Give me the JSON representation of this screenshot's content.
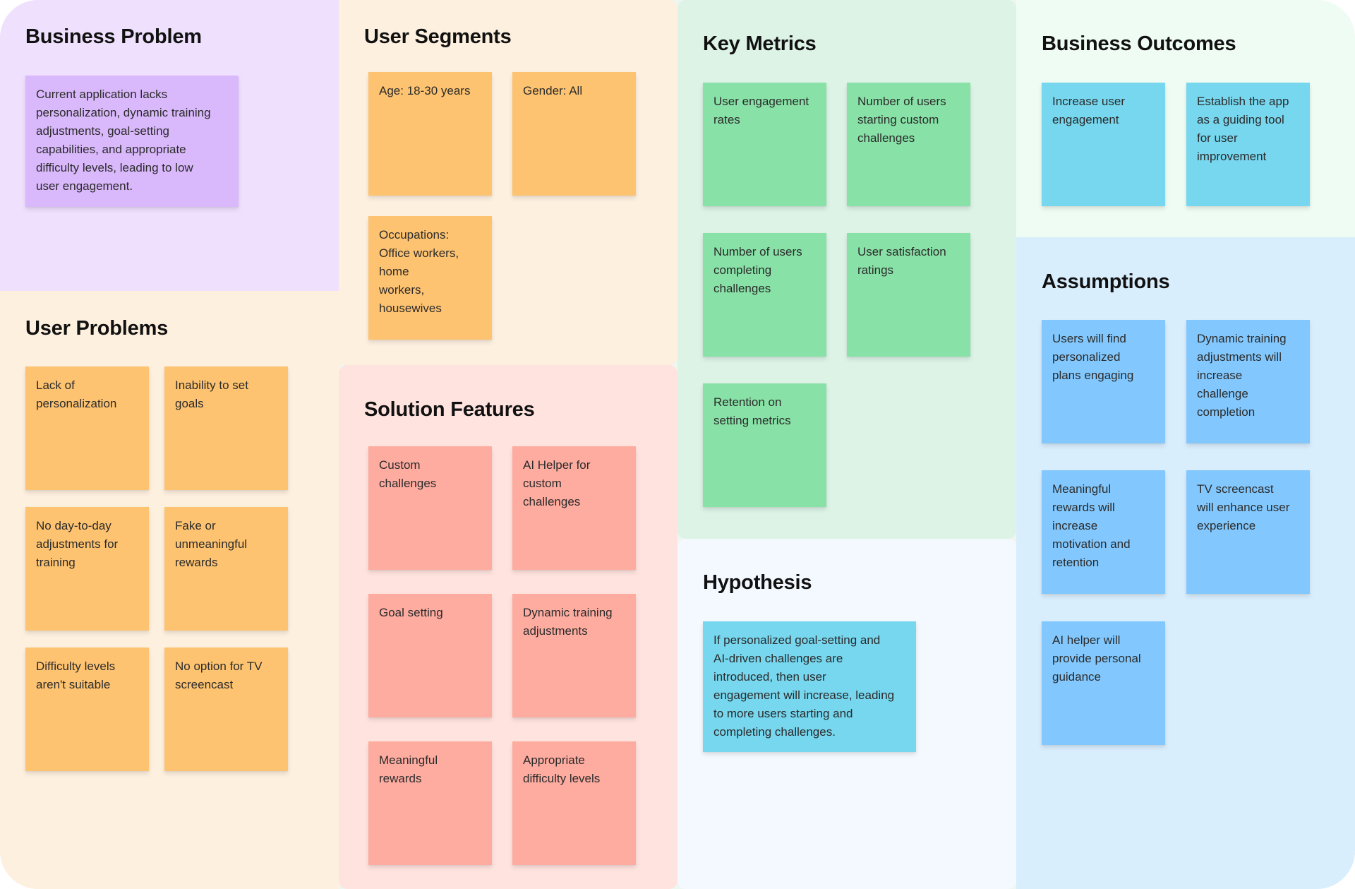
{
  "colors": {
    "business_problem_bg": "#efe0fe",
    "user_problems_bg": "#fef0df",
    "solution_bg": "#ffe3df",
    "key_metrics_bg": "#dcf3e6",
    "hypothesis_bg": "#f3f9fe",
    "outcomes_bg": "#effcf3",
    "assumptions_bg": "#d9eefd",
    "sticky_purple": "#d9b8fb",
    "sticky_orange": "#fec370",
    "sticky_pink": "#feaca0",
    "sticky_green": "#88e1a6",
    "sticky_cyan": "#76d7ef",
    "sticky_blue": "#82c8fe"
  },
  "business_problem": {
    "title": "Business Problem",
    "notes": [
      "Current application lacks\npersonalization, dynamic training\nadjustments, goal-setting\ncapabilities, and appropriate\ndifficulty levels, leading to low\nuser engagement."
    ]
  },
  "user_problems": {
    "title": "User Problems",
    "notes": [
      "Lack of\npersonalization",
      "Inability to set\ngoals",
      "No day-to-day\nadjustments for\ntraining",
      "Fake or\nunmeaningful\nrewards",
      "Difficulty levels\naren't suitable",
      "No option for TV\nscreencast"
    ]
  },
  "user_segments": {
    "title": "User Segments",
    "notes": [
      "Age: 18-30 years",
      "Gender: All",
      "Occupations:\nOffice workers,\nhome\nworkers,\nhousewives"
    ]
  },
  "solution_features": {
    "title": "Solution Features",
    "notes": [
      "Custom\nchallenges",
      "AI Helper for\ncustom\nchallenges",
      "Goal setting",
      "Dynamic training\nadjustments",
      "Meaningful\nrewards",
      "Appropriate\ndifficulty levels"
    ]
  },
  "key_metrics": {
    "title": "Key Metrics",
    "notes": [
      "User engagement\nrates",
      "Number of users\nstarting custom\nchallenges",
      "Number of users\ncompleting\nchallenges",
      "User satisfaction\nratings",
      "Retention on\nsetting metrics"
    ]
  },
  "hypothesis": {
    "title": "Hypothesis",
    "notes": [
      "If personalized goal-setting and\nAI-driven challenges are\nintroduced, then user\nengagement will increase, leading\nto more users starting and\ncompleting challenges."
    ]
  },
  "business_outcomes": {
    "title": "Business Outcomes",
    "notes": [
      "Increase user\nengagement",
      "Establish the app\nas a guiding tool\nfor user\nimprovement"
    ]
  },
  "assumptions": {
    "title": "Assumptions",
    "notes": [
      "Users will find\npersonalized\nplans engaging",
      "Dynamic training\nadjustments will\nincrease\nchallenge\ncompletion",
      "Meaningful\nrewards will\nincrease\nmotivation and\nretention",
      "TV screencast\nwill enhance user\nexperience",
      "AI helper will\nprovide personal\nguidance"
    ]
  }
}
